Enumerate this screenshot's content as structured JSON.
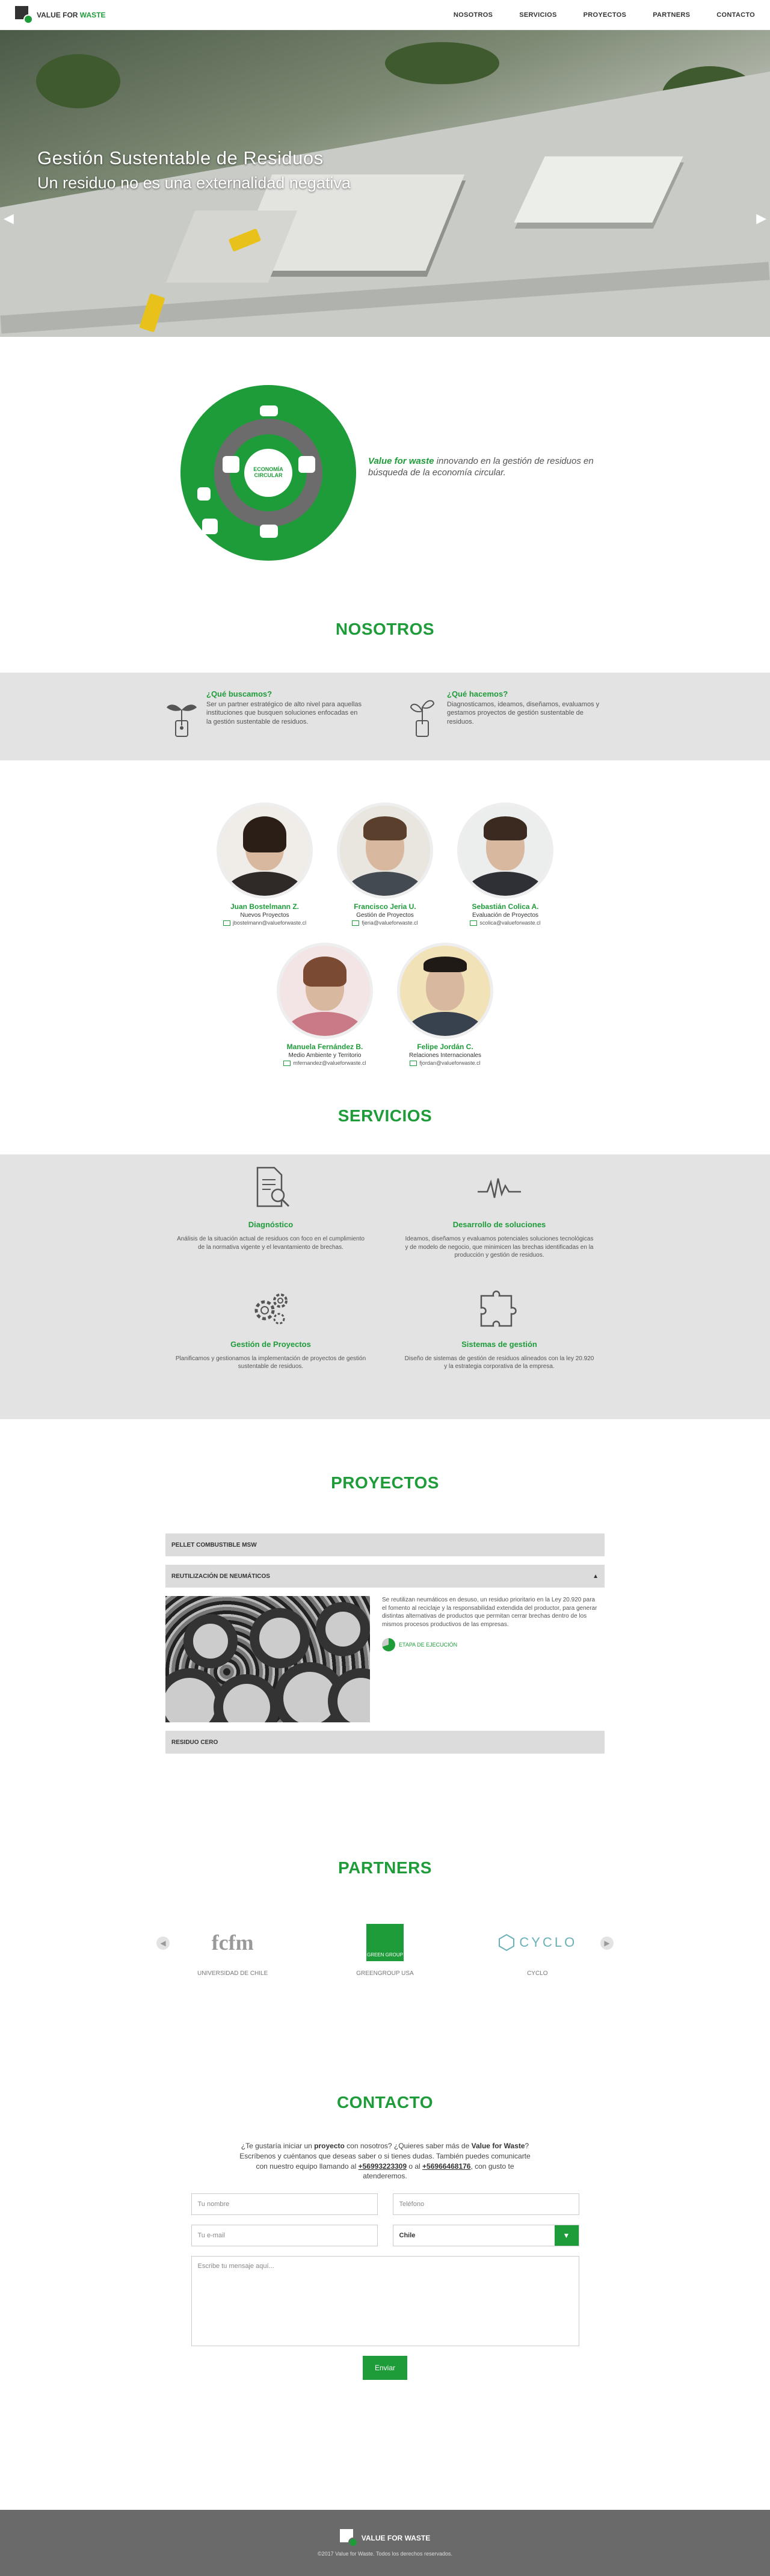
{
  "brand": {
    "name_prefix": "VALUE FOR",
    "name_suffix": "WASTE",
    "colors": {
      "accent": "#1f9c3a",
      "dark": "#333333",
      "grey_band": "#e3e3e3"
    }
  },
  "nav": {
    "items": [
      "NOSOTROS",
      "SERVICIOS",
      "PROYECTOS",
      "PARTNERS",
      "CONTACTO"
    ]
  },
  "hero": {
    "title": "Gestión Sustentable de Residuos",
    "subtitle": "Un residuo no es una externalidad negativa",
    "prev_icon": "chevron-left",
    "next_icon": "chevron-right"
  },
  "intro": {
    "brand_phrase": "Value for waste",
    "text": " innovando en la gestión de residuos en búsqueda de la economía circular.",
    "diagram_center": "ECONOMÍA CIRCULAR"
  },
  "nosotros": {
    "title": "NOSOTROS",
    "items": [
      {
        "title": "¿Qué buscamos?",
        "text": "Ser un partner estratégico de alto nivel para aquellas instituciones que busquen soluciones enfocadas en la gestión sustentable de residuos."
      },
      {
        "title": "¿Qué hacemos?",
        "text": "Diagnosticamos, ideamos, diseñamos, evaluamos y gestamos proyectos de gestión sustentable de residuos."
      }
    ],
    "team": [
      {
        "name": "Juan Bostelmann Z.",
        "role": "Nuevos Proyectos",
        "email": "jbostelmann@valueforwaste.cl"
      },
      {
        "name": "Francisco Jeria U.",
        "role": "Gestión de Proyectos",
        "email": "fjeria@valueforwaste.cl"
      },
      {
        "name": "Sebastián Colica A.",
        "role": "Evaluación de Proyectos",
        "email": "scolica@valueforwaste.cl"
      },
      {
        "name": "Manuela Fernández B.",
        "role": "Medio Ambiente y Territorio",
        "email": "mfernandez@valueforwaste.cl"
      },
      {
        "name": "Felipe Jordán C.",
        "role": "Relaciones Internacionales",
        "email": "fjordan@valueforwaste.cl"
      }
    ]
  },
  "servicios": {
    "title": "SERVICIOS",
    "items": [
      {
        "title": "Diagnóstico",
        "text": "Análisis de la situación actual de residuos con foco en el cumplimiento de la normativa vigente y el levantamiento de brechas."
      },
      {
        "title": "Desarrollo de soluciones",
        "text": "Ideamos, diseñamos y evaluamos potenciales soluciones tecnológicas y de modelo de negocio, que minimicen las brechas identificadas en la producción y gestión de residuos."
      },
      {
        "title": "Gestión de Proyectos",
        "text": "Planificamos y gestionamos la implementación de proyectos de gestión sustentable de residuos."
      },
      {
        "title": "Sistemas de gestión",
        "text": "Diseño de sistemas de gestión de residuos alineados con la ley 20.920 y la estrategia corporativa de la empresa."
      }
    ]
  },
  "proyectos": {
    "title": "PROYECTOS",
    "items": [
      "PELLET COMBUSTIBLE MSW",
      "REUTILIZACIÓN DE NEUMÁTICOS",
      "RESIDUO CERO"
    ],
    "open_text": "Se reutilizan neumáticos en desuso, un residuo prioritario en la Ley 20.920 para el fomento al reciclaje y la responsabilidad extendida del productor, para generar distintas alternativas de productos que permitan cerrar brechas dentro de los mismos procesos productivos de las empresas.",
    "open_link": "ETAPA DE EJECUCIÓN"
  },
  "partners": {
    "title": "PARTNERS",
    "items": [
      {
        "logo": "fcfm",
        "name": "UNIVERSIDAD DE CHILE"
      },
      {
        "logo": "GREEN GROUP",
        "name": "GREENGROUP USA"
      },
      {
        "logo": "CYCLO",
        "name": "CYCLO"
      }
    ]
  },
  "contacto": {
    "title": "CONTACTO",
    "text_1": "¿Te gustaría iniciar un ",
    "text_bold_1": "proyecto",
    "text_2": " con nosotros? ¿Quieres saber más de ",
    "text_bold_2": "Value for Waste",
    "text_3": "? Escríbenos y cuéntanos que deseas saber o si tienes dudas. También puedes comunicarte con nuestro equipo llamando al ",
    "phone_1": "+56993223309",
    "text_4": " o al ",
    "phone_2": "+56966468176",
    "text_5": ", con gusto te atenderemos.",
    "fields": {
      "name": "Tu nombre",
      "phone": "Teléfono",
      "email": "Tu e-mail",
      "country": "Chile",
      "message": "Escribe tu mensaje aquí..."
    },
    "send": "Enviar"
  },
  "footer": {
    "copyright": "©2017 Value for Waste. Todos los derechos reservados."
  }
}
